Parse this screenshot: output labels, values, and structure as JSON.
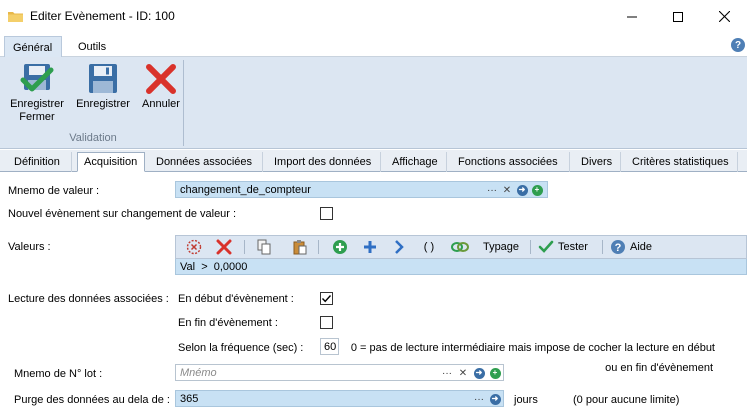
{
  "window": {
    "title": "Editer Evènement - ID: 100"
  },
  "ribbon_tabs": [
    {
      "label": "Général",
      "active": true
    },
    {
      "label": "Outils",
      "active": false
    }
  ],
  "ribbon_buttons": {
    "save_close_line1": "Enregistrer",
    "save_close_line2": "Fermer",
    "save": "Enregistrer",
    "cancel": "Annuler"
  },
  "ribbon_group": "Validation",
  "property_tabs": [
    "Définition",
    "Acquisition",
    "Données associées",
    "Import des données",
    "Affichage",
    "Fonctions associées",
    "Divers",
    "Critères statistiques"
  ],
  "active_property_tab": "Acquisition",
  "form": {
    "mnemo_valeur_label": "Mnemo de valeur :",
    "mnemo_valeur_value": "changement_de_compteur",
    "nouvel_evt_label": "Nouvel évènement sur changement de valeur :",
    "nouvel_evt_checked": false,
    "valeurs_label": "Valeurs :",
    "valeurs_toolbar": {
      "typage": "Typage",
      "tester": "Tester",
      "aide": "Aide",
      "paren": "( )"
    },
    "valeurs_expression": "Val  >  0,0000",
    "lecture_label": "Lecture des données associées :",
    "debut_label": "En début d'évènement :",
    "debut_checked": true,
    "fin_label": "En fin d'évènement :",
    "fin_checked": false,
    "frequence_label": "Selon la fréquence (sec) :",
    "frequence_value": "60",
    "frequence_note_line1": "0 = pas de lecture intermédiaire mais impose de cocher la lecture en début",
    "frequence_note_line2": "ou en fin d'évènement",
    "mnemo_lot_label": "Mnemo de N° lot :",
    "mnemo_lot_placeholder": "Mnémo",
    "purge_label": "Purge des données au dela de :",
    "purge_value": "365",
    "purge_unit": "jours",
    "purge_note": "(0 pour aucune limite)"
  },
  "colors": {
    "ribbon_bg": "#dce6f2",
    "field_bg": "#c8e1f4",
    "save_green": "#2e9e4f",
    "cancel_red": "#d9322b",
    "disk_blue": "#3a6ea5"
  }
}
